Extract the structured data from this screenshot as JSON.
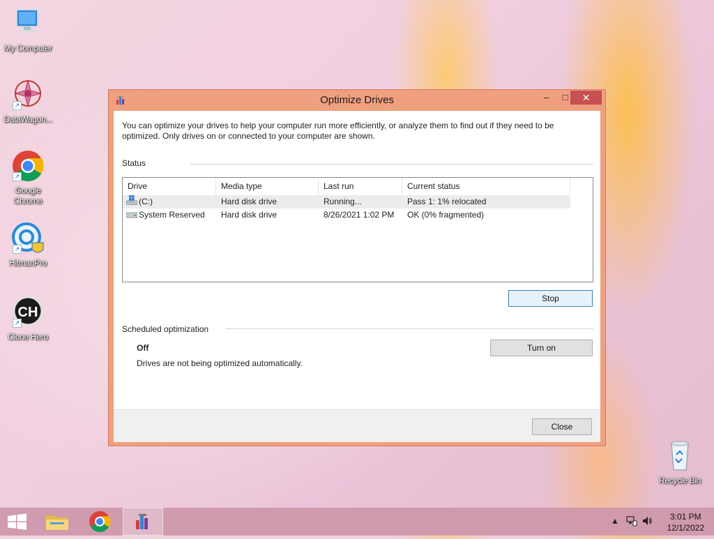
{
  "desktop": {
    "icons": [
      {
        "label": "My Computer",
        "icon": "computer-icon"
      },
      {
        "label": "DataWagon...",
        "icon": "datawagon-icon"
      },
      {
        "label": "Google Chrome",
        "icon": "chrome-icon"
      },
      {
        "label": "HitmanPro",
        "icon": "hitmanpro-icon"
      },
      {
        "label": "Clone Hero",
        "icon": "clone-hero-icon"
      },
      {
        "label": "Recycle Bin",
        "icon": "recycle-bin-icon"
      }
    ],
    "clone_hero_glyph": "CH"
  },
  "window": {
    "title": "Optimize Drives",
    "controls": {
      "minimize": "–",
      "maximize": "□",
      "close": "✕"
    },
    "description": "You can optimize your drives to help your computer run more efficiently, or analyze them to find out if they need to be optimized. Only drives on or connected to your computer are shown.",
    "status": {
      "title": "Status",
      "columns": [
        "Drive",
        "Media type",
        "Last run",
        "Current status"
      ],
      "rows": [
        {
          "drive": "(C:)",
          "media": "Hard disk drive",
          "last_run": "Running...",
          "status": "Pass 1: 1% relocated",
          "selected": true,
          "icon": "windows-drive-icon"
        },
        {
          "drive": "System Reserved",
          "media": "Hard disk drive",
          "last_run": "8/26/2021 1:02 PM",
          "status": "OK (0% fragmented)",
          "selected": false,
          "icon": "drive-icon"
        }
      ],
      "stop_label": "Stop"
    },
    "schedule": {
      "title": "Scheduled optimization",
      "state": "Off",
      "note": "Drives are not being optimized automatically.",
      "turn_on_label": "Turn on"
    },
    "close_label": "Close"
  },
  "taskbar": {
    "items": [
      "start-button",
      "file-explorer",
      "chrome",
      "optimize-drives"
    ],
    "active_item": "optimize-drives",
    "tray": {
      "show_hidden": "▲"
    },
    "clock": {
      "time": "3:01 PM",
      "date": "12/1/2022"
    }
  },
  "colors": {
    "window_frame": "#f0a07f",
    "close_button": "#c75050",
    "accent": "#3c7fb1"
  }
}
